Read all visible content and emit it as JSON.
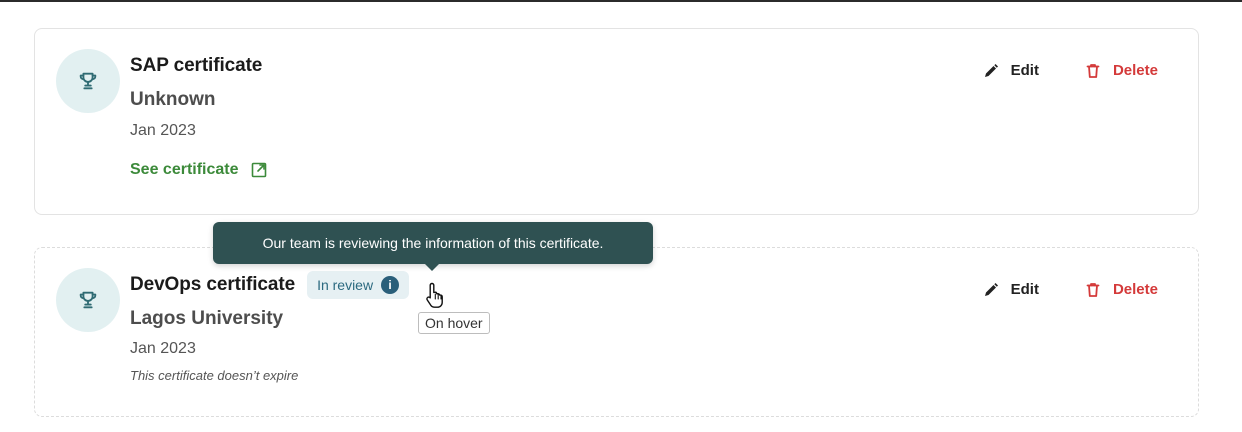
{
  "certificates": [
    {
      "title": "SAP certificate",
      "issuer": "Unknown",
      "date": "Jan 2023",
      "link_label": "See certificate",
      "edit_label": "Edit",
      "delete_label": "Delete"
    },
    {
      "title": "DevOps certificate",
      "badge": "In review",
      "issuer": "Lagos University",
      "date": "Jan 2023",
      "note": "This certificate doesn’t expire",
      "edit_label": "Edit",
      "delete_label": "Delete"
    }
  ],
  "tooltip": {
    "text": "Our team is reviewing the information of this certificate."
  },
  "annotation": {
    "hover_label": "On hover"
  },
  "icons": {
    "award": "trophy-icon",
    "edit": "pencil-icon",
    "delete": "trash-icon",
    "external_link": "external-link-icon",
    "info": "info-icon",
    "cursor": "hand-pointer-icon"
  },
  "colors": {
    "avatar_bg": "#e2f0f1",
    "trophy": "#2f6b73",
    "link_green": "#3c8a3a",
    "delete_red": "#d43a3a",
    "badge_bg": "#e6f0f3",
    "badge_text": "#2c6a80",
    "tooltip_bg": "#2f5152"
  }
}
